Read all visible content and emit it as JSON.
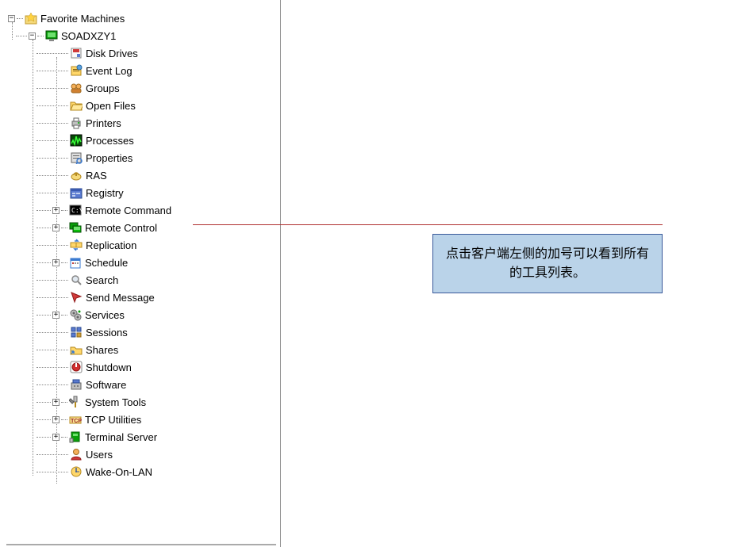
{
  "tree": {
    "root_label": "Favorite Machines",
    "machine_label": "SOADXZY1",
    "items": [
      {
        "label": "Disk Drives",
        "icon": "disk",
        "expandable": false
      },
      {
        "label": "Event Log",
        "icon": "eventlog",
        "expandable": false
      },
      {
        "label": "Groups",
        "icon": "groups",
        "expandable": false
      },
      {
        "label": "Open Files",
        "icon": "openfiles",
        "expandable": false
      },
      {
        "label": "Printers",
        "icon": "printers",
        "expandable": false
      },
      {
        "label": "Processes",
        "icon": "processes",
        "expandable": false
      },
      {
        "label": "Properties",
        "icon": "properties",
        "expandable": false
      },
      {
        "label": "RAS",
        "icon": "ras",
        "expandable": false
      },
      {
        "label": "Registry",
        "icon": "registry",
        "expandable": false
      },
      {
        "label": "Remote Command",
        "icon": "remotecmd",
        "expandable": true
      },
      {
        "label": "Remote Control",
        "icon": "remotectrl",
        "expandable": true
      },
      {
        "label": "Replication",
        "icon": "replication",
        "expandable": false
      },
      {
        "label": "Schedule",
        "icon": "schedule",
        "expandable": true
      },
      {
        "label": "Search",
        "icon": "search",
        "expandable": false
      },
      {
        "label": "Send Message",
        "icon": "sendmsg",
        "expandable": false
      },
      {
        "label": "Services",
        "icon": "services",
        "expandable": true
      },
      {
        "label": "Sessions",
        "icon": "sessions",
        "expandable": false
      },
      {
        "label": "Shares",
        "icon": "shares",
        "expandable": false
      },
      {
        "label": "Shutdown",
        "icon": "shutdown",
        "expandable": false
      },
      {
        "label": "Software",
        "icon": "software",
        "expandable": false
      },
      {
        "label": "System Tools",
        "icon": "systemtools",
        "expandable": true
      },
      {
        "label": "TCP Utilities",
        "icon": "tcp",
        "expandable": true
      },
      {
        "label": "Terminal Server",
        "icon": "terminal",
        "expandable": true
      },
      {
        "label": "Users",
        "icon": "users",
        "expandable": false
      },
      {
        "label": "Wake-On-LAN",
        "icon": "wakeonlan",
        "expandable": false
      }
    ]
  },
  "callout": {
    "text": "点击客户端左侧的加号可以看到所有的工具列表。"
  },
  "expander": {
    "minus": "−",
    "plus": "+"
  }
}
